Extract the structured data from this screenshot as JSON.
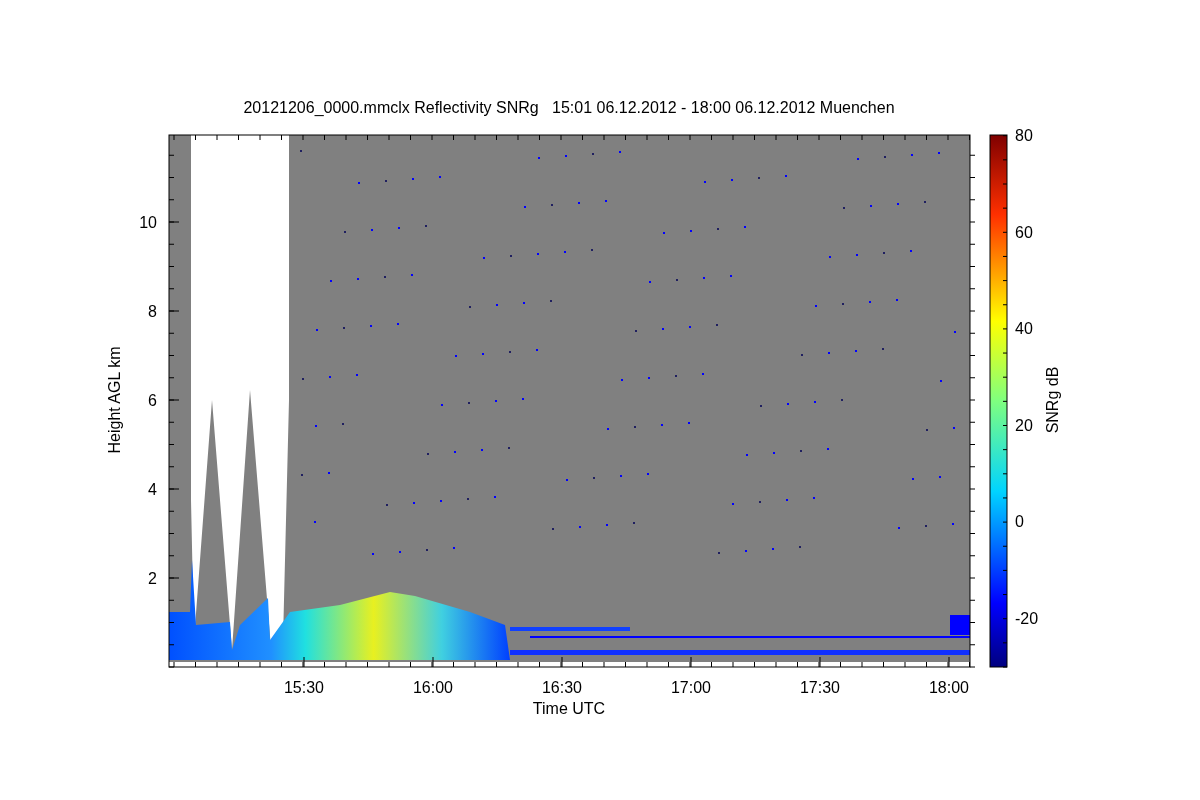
{
  "title": "20121206_0000.mmclx Reflectivity SNRg   15:01 06.12.2012 - 18:00 06.12.2012 Muenchen",
  "x_axis": {
    "label": "Time UTC",
    "ticks": [
      "15:30",
      "16:00",
      "16:30",
      "17:00",
      "17:30",
      "18:00"
    ]
  },
  "y_axis": {
    "label": "Height AGL km",
    "ticks": [
      "10",
      "8",
      "6",
      "4",
      "2"
    ]
  },
  "colorbar": {
    "label": "SNRg dB",
    "ticks": [
      "80",
      "60",
      "40",
      "20",
      "0",
      "-20"
    ]
  }
}
